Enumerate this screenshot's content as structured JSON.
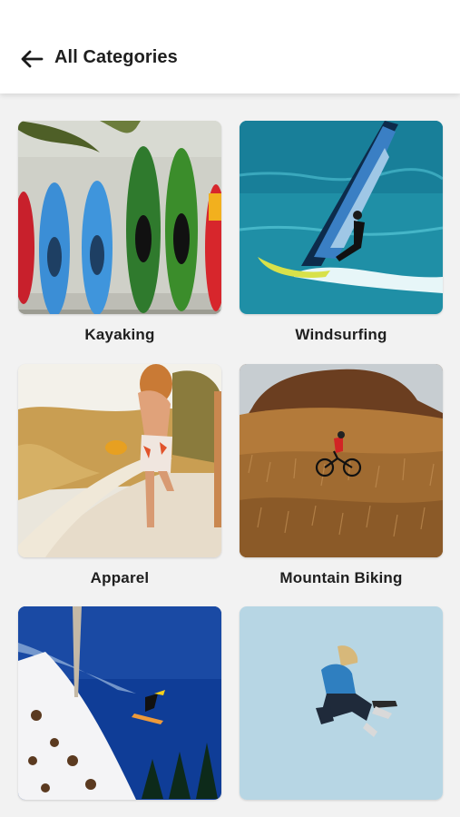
{
  "header": {
    "back_icon": "arrow-left-icon",
    "title": "All Categories"
  },
  "categories": [
    {
      "label": "Kayaking"
    },
    {
      "label": "Windsurfing"
    },
    {
      "label": "Apparel"
    },
    {
      "label": "Mountain Biking"
    },
    {
      "label": ""
    },
    {
      "label": ""
    }
  ],
  "colors": {
    "background": "#f2f2f2",
    "header_bg": "#ffffff",
    "text": "#1f1f1f"
  }
}
